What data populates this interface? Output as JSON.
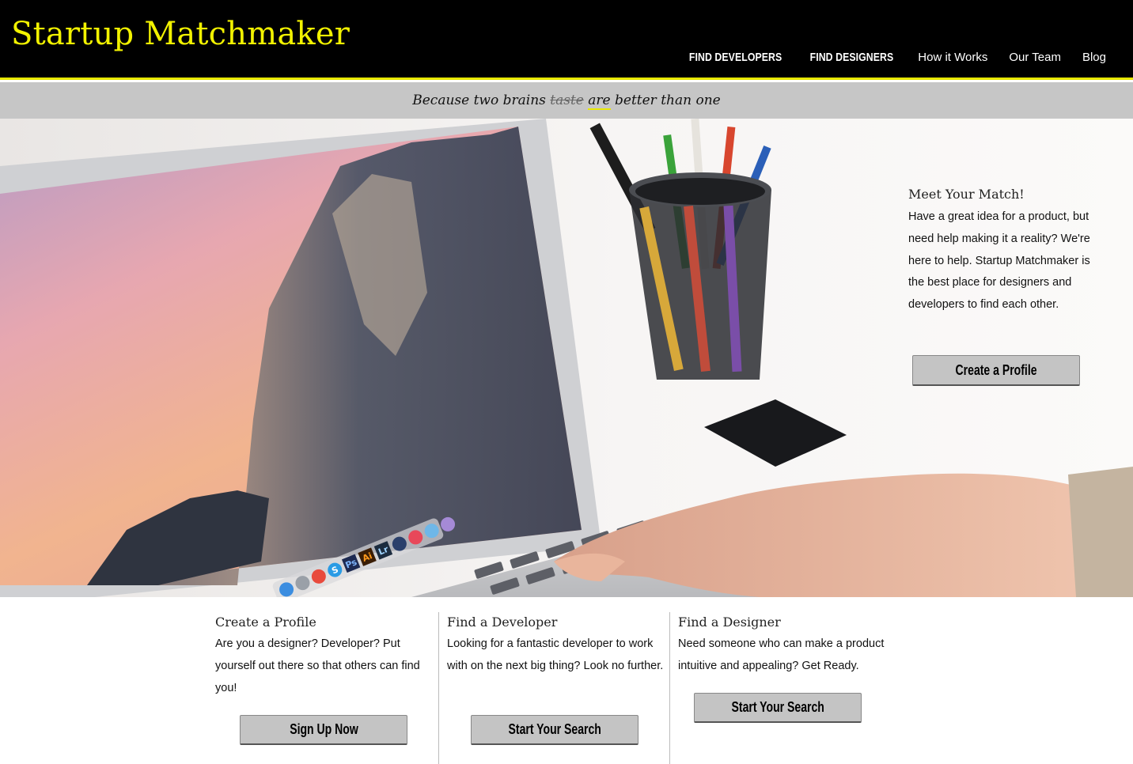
{
  "brand": {
    "title": "Startup Matchmaker"
  },
  "nav": {
    "items": [
      {
        "label": "FIND DEVELOPERS"
      },
      {
        "label": "FIND DESIGNERS"
      },
      {
        "label": "How it Works"
      },
      {
        "label": "Our Team"
      },
      {
        "label": "Blog"
      }
    ]
  },
  "tagline": {
    "before": "Because two brains",
    "struck": "taste",
    "underlined": "are",
    "after": "better than one"
  },
  "hero": {
    "dock_icon_labels": [
      "S",
      "Ps",
      "Ai",
      "Lr"
    ],
    "match": {
      "title": "Meet Your Match!",
      "text": "Have a great idea for a product, but need help making it a reality? We're here to help. Startup Matchmaker is the best place for designers and developers to find each other.",
      "button": "Create a Profile"
    }
  },
  "columns": [
    {
      "title": "Create a Profile",
      "text": "Are you a designer? Developer? Put yourself out there so that others can find you!",
      "button": "Sign Up Now"
    },
    {
      "title": "Find a Developer",
      "text": "Looking for a fantastic developer to work with on the next big thing? Look no further.",
      "button": "Start Your Search"
    },
    {
      "title": "Find a Designer",
      "text": "Need someone who can make a product intuitive and appealing? Get Ready.",
      "button": "Start Your Search"
    }
  ],
  "colors": {
    "header_bg": "#000000",
    "brand": "#f2f200",
    "accent_border": "#e8e800",
    "tagline_bg": "#c6c6c6",
    "button_bg": "#c4c4c4"
  }
}
